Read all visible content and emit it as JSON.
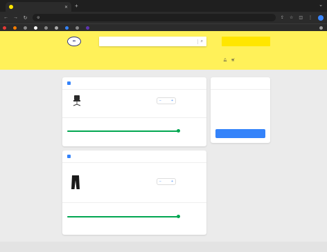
{
  "browser": {
    "tab_title": "",
    "url": "",
    "bookmarks": [
      "",
      "",
      "",
      "",
      "",
      "",
      "",
      "",
      "",
      ""
    ]
  },
  "colors": {
    "header_yellow": "#fff159",
    "accent_blue": "#3483fa",
    "green": "#00a650"
  },
  "header": {
    "logo_text": "",
    "search_placeholder": "",
    "location": "",
    "categories": [
      "",
      "",
      "",
      "",
      "",
      "",
      ""
    ],
    "user_nav": [
      "",
      "",
      "",
      ""
    ]
  },
  "sellers": [
    {
      "title": "",
      "product": {
        "title": "",
        "subtitle": "",
        "actions": [
          "",
          "",
          ""
        ],
        "qty": "",
        "stock_note": "",
        "price_old": "",
        "price": ""
      },
      "shipping": {
        "label": "",
        "value": ""
      },
      "progress": {
        "fraction": 1.0,
        "label": ""
      },
      "note": {
        "text": "",
        "link": ""
      }
    },
    {
      "title": "",
      "product": {
        "title": "",
        "subtitle": "",
        "actions": [
          "",
          "",
          ""
        ],
        "qty": "",
        "stock_note": "",
        "price_old": "",
        "price": ""
      },
      "shipping": {
        "label": "",
        "value": ""
      },
      "progress": {
        "fraction": 1.0,
        "label": ""
      },
      "note": {
        "text": "",
        "link": ""
      }
    }
  ],
  "summary": {
    "title": "",
    "rows": [
      {
        "label": "",
        "value": ""
      },
      {
        "label": "",
        "value": ""
      },
      {
        "label": "",
        "value": ""
      }
    ],
    "total_label": "",
    "total_value": "",
    "button": ""
  }
}
